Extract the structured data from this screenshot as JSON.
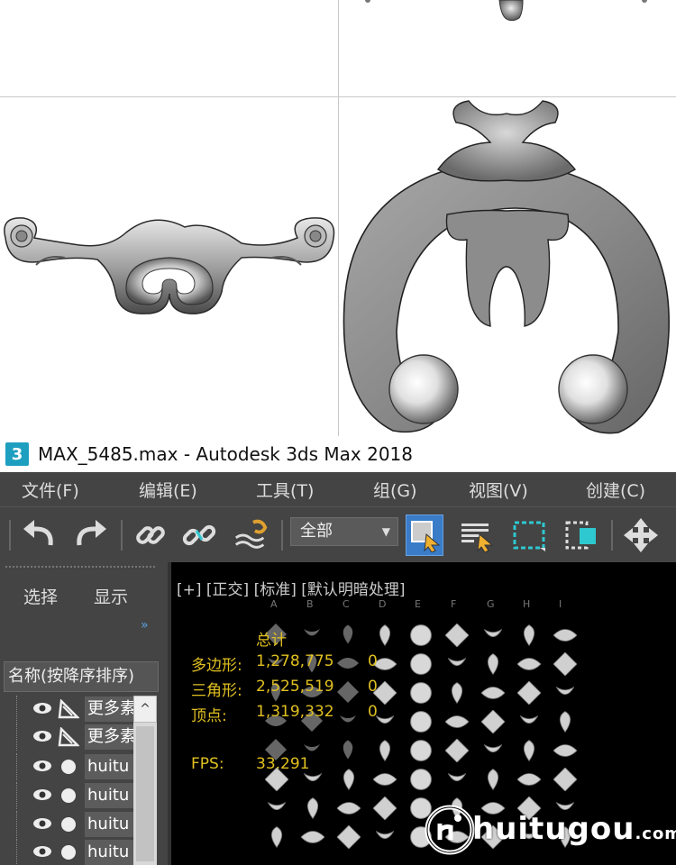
{
  "window": {
    "logo_glyph": "3",
    "title": "MAX_5485.max - Autodesk 3ds Max 2018"
  },
  "menu": [
    {
      "label": "文件(F)"
    },
    {
      "label": "编辑(E)"
    },
    {
      "label": "工具(T)"
    },
    {
      "label": "组(G)"
    },
    {
      "label": "视图(V)"
    },
    {
      "label": "创建(C)"
    }
  ],
  "toolbar": {
    "icons": [
      "undo-icon",
      "redo-icon",
      "link-icon",
      "unlink-icon",
      "bind-space-warp-icon",
      "select-object-icon",
      "select-by-name-icon",
      "rectangular-selection-icon",
      "window-crossing-icon",
      "move-icon"
    ],
    "selection_filter": "全部"
  },
  "explorer": {
    "tabs": [
      "选择",
      "显示"
    ],
    "expand_glyph": "»",
    "sort_header": "名称(按降序排序)",
    "items": [
      {
        "label": "更多素",
        "kind": "bone"
      },
      {
        "label": "更多素",
        "kind": "bone"
      },
      {
        "label": "huitu",
        "kind": "geometry"
      },
      {
        "label": "huitu",
        "kind": "geometry"
      },
      {
        "label": "huitu",
        "kind": "geometry"
      },
      {
        "label": "huitu",
        "kind": "geometry"
      }
    ],
    "scroll_up_glyph": "^"
  },
  "viewport": {
    "label": "[+] [正交] [标准] [默认明暗处理]",
    "column_letters": [
      "A",
      "B",
      "C",
      "D",
      "E",
      "F",
      "G",
      "H",
      "I"
    ],
    "stats": {
      "header": "总计",
      "polygons_label": "多边形:",
      "polygons_value": "1,278,775",
      "polygons_sel": "0",
      "triangles_label": "三角形:",
      "triangles_value": "2,525,519",
      "triangles_sel": "0",
      "vertices_label": "顶点:",
      "vertices_value": "1,319,332",
      "vertices_sel": "0",
      "fps_label": "FPS:",
      "fps_value": "33.291"
    }
  },
  "watermark": {
    "brand": "huitugou",
    "suffix": ".com"
  },
  "colors": {
    "ui_dark": "#444444",
    "stats_yellow": "#e0c020",
    "accent_blue": "#1f9fc0",
    "selection_blue": "#3a7cc8",
    "selection_cyan": "#2ec8d0"
  }
}
